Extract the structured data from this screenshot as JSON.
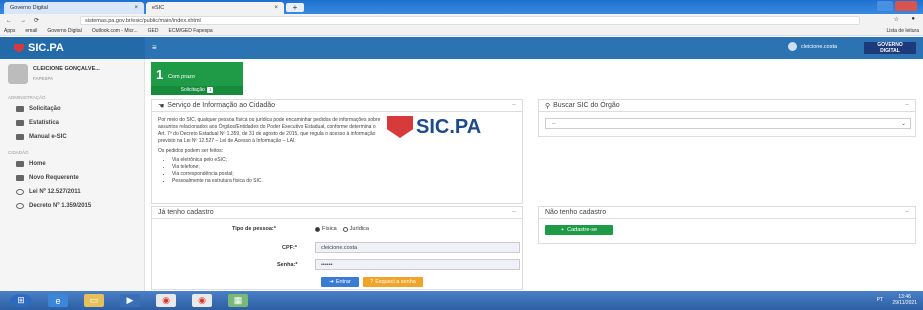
{
  "browser": {
    "tabs": [
      {
        "label": "Governo Digital"
      },
      {
        "label": "eSIC"
      }
    ],
    "url": "sistemas.pa.gov.br/esic/public/main/index.xhtml",
    "bookmarks": [
      "Apps",
      "email",
      "Governo Digital",
      "Outlook.com - Micr...",
      "GED",
      "ECM/GED Fapespa"
    ],
    "bookmarks_right": "Lista de leitura"
  },
  "header": {
    "logo": "SIC.PA",
    "user_name": "cleicione.costa",
    "gov_badge_line1": "GOVERNO",
    "gov_badge_line2": "DIGITAL"
  },
  "sidebar": {
    "profile_name": "CLEICIONE GONÇALVE...",
    "profile_role": "FAPESPA",
    "admin_section": "ADMINISTRAÇÃO",
    "admin_items": [
      "Solicitação",
      "Estatística",
      "Manual e-SIC"
    ],
    "citizen_section": "CIDADÃO",
    "citizen_items": [
      "Home",
      "Novo Requerente",
      "Lei Nº 12.527/2011",
      "Decreto Nº 1.359/2015"
    ]
  },
  "summary_box": {
    "count": "1",
    "label": "Com prazo",
    "footer": "Solicitação",
    "badge": "1"
  },
  "info_panel": {
    "title": "Serviço de Informação ao Cidadão",
    "paragraph": "Por meio do SIC, qualquer pessoa física ou jurídica pode encaminhar pedidos de informações sobre assuntos relacionados aos Órgãos/Entidades do Poder Executivo Estadual, conforme determina o Art. 7º do Decreto Estadual Nº 1.359, de 31 de agosto de 2015, que regula o acesso à informação previsto na Lei Nº 12.527 – Lei de Acesso à Informação – LAI.",
    "ways_intro": "Os pedidos podem ser feitos:",
    "ways": [
      "Via eletrônica pelo eSIC;",
      "Via telefone;",
      "Via correspondência postal;",
      "Pessoalmente na estrutura física do SIC."
    ],
    "logo_text": "SIC.PA"
  },
  "search_panel": {
    "title": "Buscar SIC do Órgão",
    "select_value": "--"
  },
  "login_panel": {
    "title": "Já tenho cadastro",
    "person_type_label": "Tipo de pessoa:*",
    "option_fisica": "Física",
    "option_juridica": "Jurídica",
    "cpf_label": "CPF:*",
    "cpf_value": "cleicione.costa",
    "password_label": "Senha:*",
    "password_value": "••••••",
    "enter_button": "Entrar",
    "forgot_button": "Esqueci a senha"
  },
  "register_panel": {
    "title": "Não tenho cadastro",
    "register_button": "Cadastre-se"
  },
  "taskbar": {
    "time": "13:46",
    "date": "29/11/2021",
    "lang": "PT"
  },
  "colors": {
    "brand_blue": "#2b73b3",
    "green": "#1f9a46",
    "orange": "#f0a52a",
    "blue_button": "#3a7bd5"
  }
}
